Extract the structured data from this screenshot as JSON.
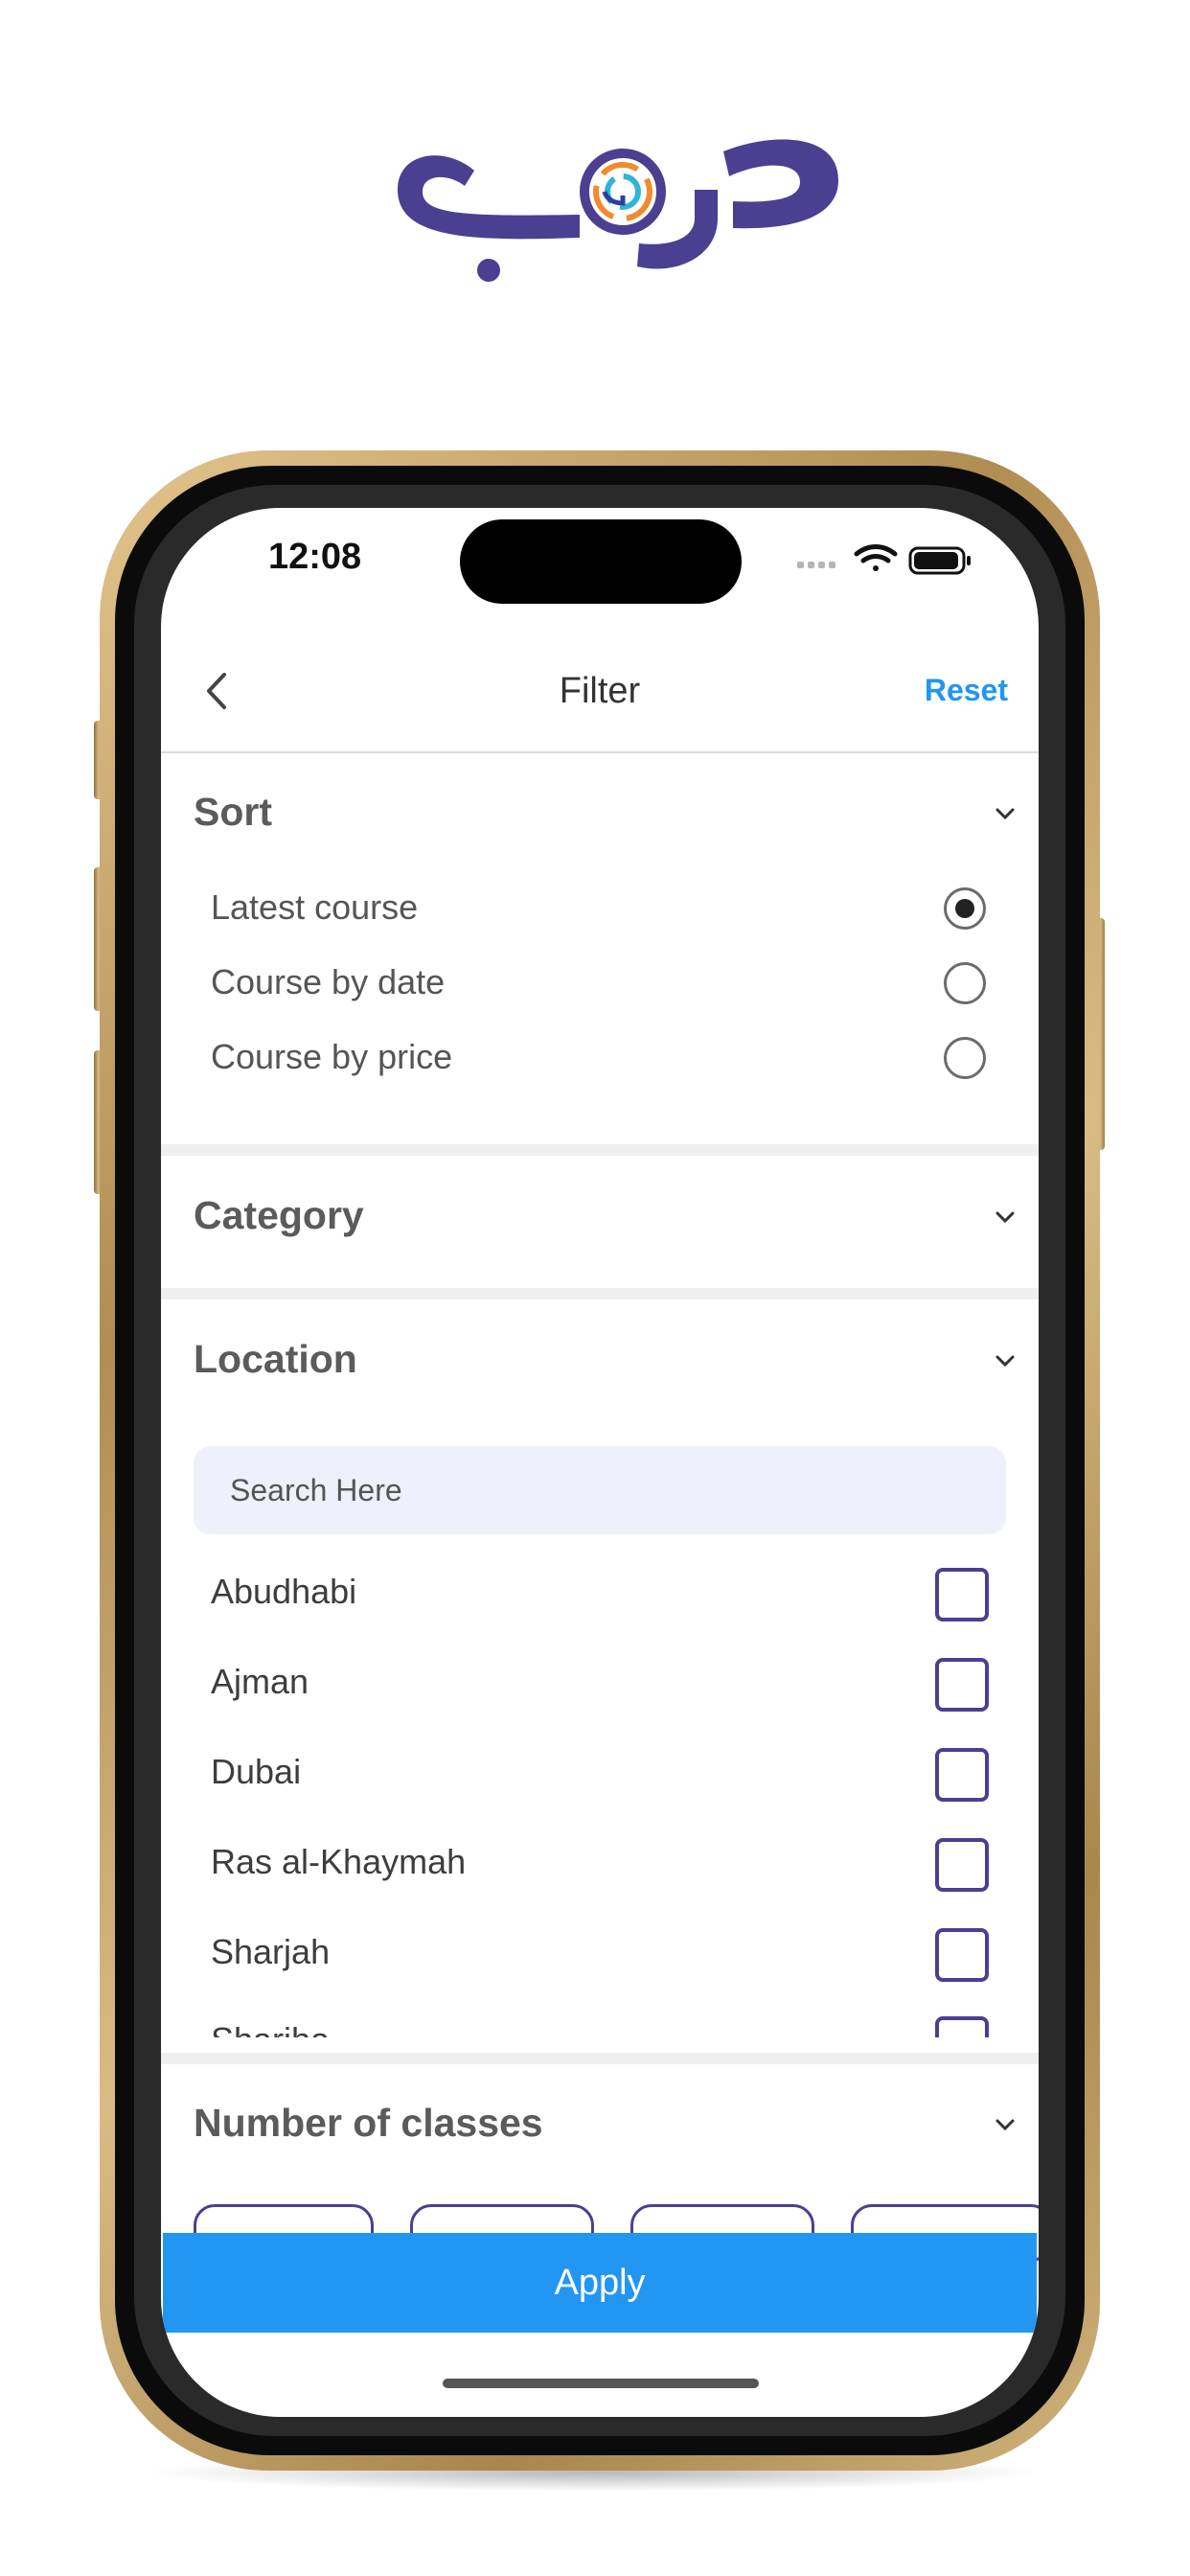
{
  "brand": {
    "logo_text": "دروب",
    "logo_color": "#4b3f92"
  },
  "status_bar": {
    "time": "12:08"
  },
  "nav": {
    "title": "Filter",
    "reset_label": "Reset",
    "back_icon": "chevron-left-icon"
  },
  "sort": {
    "title": "Sort",
    "options": [
      {
        "label": "Latest course",
        "selected": true
      },
      {
        "label": "Course by date",
        "selected": false
      },
      {
        "label": "Course by price",
        "selected": false
      }
    ]
  },
  "category": {
    "title": "Category"
  },
  "location": {
    "title": "Location",
    "search_placeholder": "Search Here",
    "items": [
      {
        "label": "Abudhabi",
        "checked": false
      },
      {
        "label": "Ajman",
        "checked": false
      },
      {
        "label": "Dubai",
        "checked": false
      },
      {
        "label": "Ras al-Khaymah",
        "checked": false
      },
      {
        "label": "Sharjah",
        "checked": false
      },
      {
        "label": "Shariha",
        "checked": false
      }
    ]
  },
  "classes": {
    "title": "Number of classes"
  },
  "apply_label": "Apply",
  "colors": {
    "accent": "#2196f3",
    "brand": "#4b3f92",
    "search_bg": "#eef1fb"
  }
}
